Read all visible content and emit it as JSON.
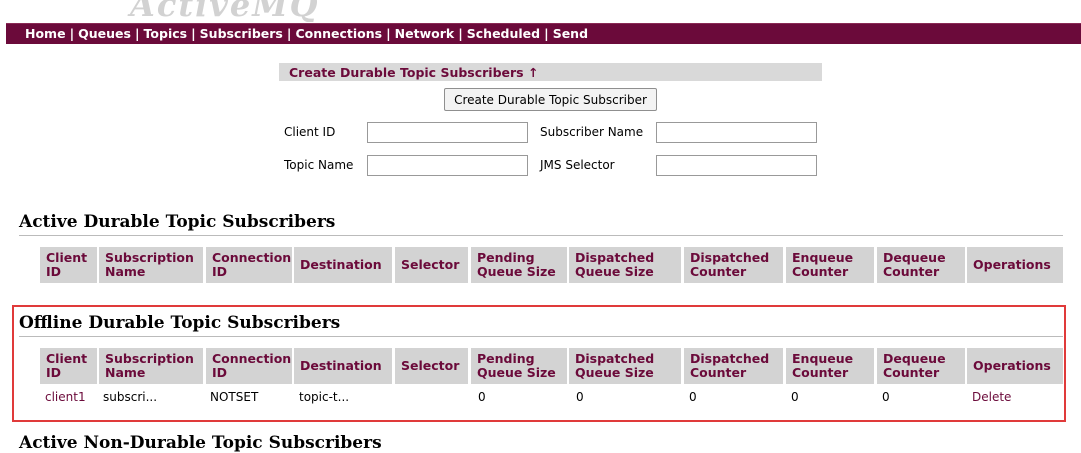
{
  "logo": {
    "text": "ActiveMQ"
  },
  "nav": {
    "items": [
      "Home",
      "Queues",
      "Topics",
      "Subscribers",
      "Connections",
      "Network",
      "Scheduled",
      "Send"
    ]
  },
  "create_form": {
    "header": "Create Durable Topic Subscribers ↑",
    "button": "Create Durable Topic Subscriber",
    "client_id_label": "Client ID",
    "subscriber_name_label": "Subscriber Name",
    "topic_name_label": "Topic Name",
    "jms_selector_label": "JMS Selector",
    "client_id_value": "",
    "subscriber_name_value": "",
    "topic_name_value": "",
    "jms_selector_value": ""
  },
  "columns": [
    "Client ID",
    "Subscription Name",
    "Connection ID",
    "Destination",
    "Selector",
    "Pending Queue Size",
    "Dispatched Queue Size",
    "Dispatched Counter",
    "Enqueue Counter",
    "Dequeue Counter",
    "Operations"
  ],
  "active": {
    "title": "Active Durable Topic Subscribers"
  },
  "offline": {
    "title": "Offline Durable Topic Subscribers",
    "rows": [
      {
        "client_id": "client1",
        "subscription_name": "subscri...",
        "connection_id": "NOTSET",
        "destination": "topic-t...",
        "selector": "",
        "pending_queue_size": "0",
        "dispatched_queue_size": "0",
        "dispatched_counter": "0",
        "enqueue_counter": "0",
        "dequeue_counter": "0",
        "operation": "Delete"
      }
    ]
  },
  "partial_section": {
    "title": "Active Non-Durable Topic Subscribers"
  },
  "colors": {
    "brand": "#6b0a3a",
    "header_bg": "#d3d3d3",
    "highlight": "#e03a3a"
  }
}
